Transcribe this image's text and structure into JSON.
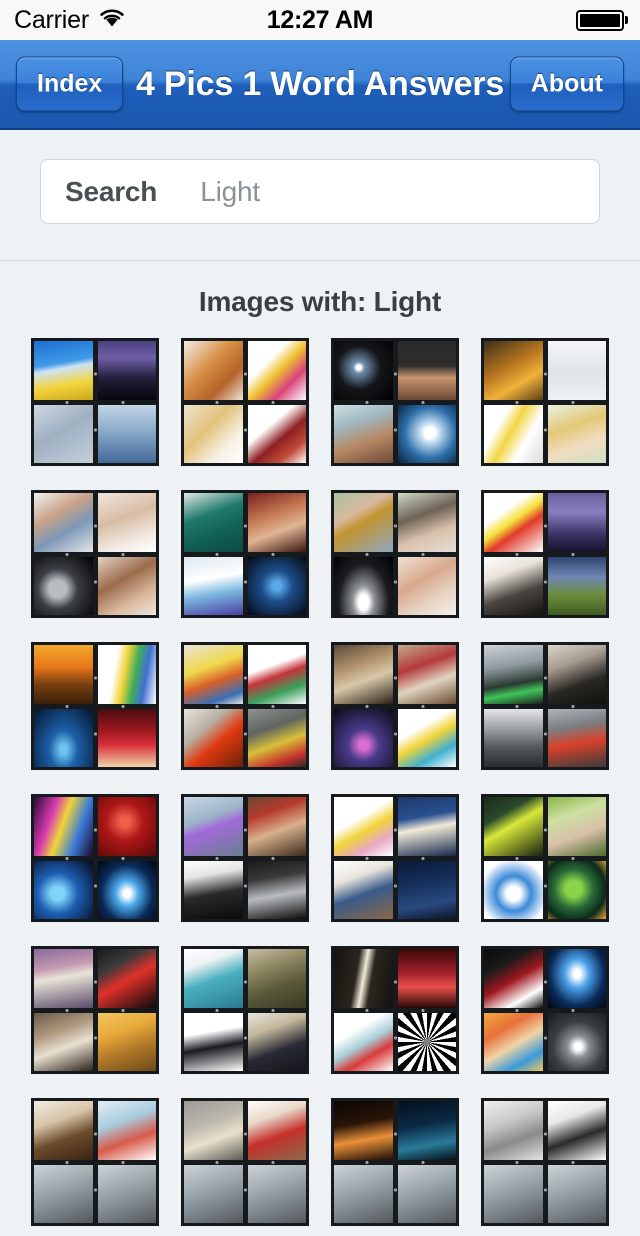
{
  "status_bar": {
    "carrier": "Carrier",
    "wifi_icon": "wifi-icon",
    "time": "12:27 AM",
    "battery_icon": "battery-full-icon"
  },
  "nav_bar": {
    "title": "4 Pics 1 Word Answers",
    "left_button": "Index",
    "right_button": "About",
    "accent_color": "#2a6ccb"
  },
  "search": {
    "label": "Search",
    "value": "Light",
    "placeholder": "Search"
  },
  "results": {
    "heading": "Images with: Light",
    "tiles": [
      {
        "name": "puzzle-sunflowers-lightning-frost-rain",
        "panes": [
          {
            "desc": "sun-over-sunflower-field",
            "css": "linear-gradient(170deg,#1d6fd0 0%,#3f9ae8 38%,#cfe4f4 47%,#f3d33a 72%,#c9a81d 100%)"
          },
          {
            "desc": "lightning-bolt-night-sky",
            "css": "linear-gradient(180deg,#4b3f7e 0%,#6f5fa8 28%,#241f3d 62%,#07060c 100%)"
          },
          {
            "desc": "frosted-leaves-monochrome",
            "css": "linear-gradient(150deg,#cfd8e2 0%,#9fb0c2 45%,#c4ced9 100%)"
          },
          {
            "desc": "blue-rain-on-water",
            "css": "linear-gradient(180deg,#c3d4e6 0%,#8fb0cd 40%,#44699a 100%)"
          }
        ]
      },
      {
        "name": "puzzle-redhead-confetti-blonde-filmstrip",
        "panes": [
          {
            "desc": "redhead-woman-red-lips",
            "css": "linear-gradient(135deg,#f2ece6 0%,#d79044 42%,#b4622a 70%,#f0e2d6 100%)"
          },
          {
            "desc": "colorful-paint-splashes",
            "css": "linear-gradient(135deg,#ffffff 0%,#ffffff 34%,#f0c230 52%,#d8427a 72%,#ffffff 100%)"
          },
          {
            "desc": "blonde-curly-hair-woman",
            "css": "linear-gradient(135deg,#efe4d2 0%,#e2c27a 40%,#f7efe3 72%,#ffffff 100%)"
          },
          {
            "desc": "red-film-strip",
            "css": "linear-gradient(140deg,#ffffff 0%,#ffffff 36%,#8e1f22 58%,#c24b3a 78%,#ffffff 100%)"
          }
        ]
      },
      {
        "name": "puzzle-disco-ball-halo-woman-bulb",
        "panes": [
          {
            "desc": "disco-ball-in-dark",
            "css": "radial-gradient(circle at 42% 45%, #ffffff 0 5%, #6f8fae 12%, #141619 46%, #000000 100%)"
          },
          {
            "desc": "man-with-halo-over-head",
            "css": "linear-gradient(180deg,#2a2a2a 0%,#2e2e2e 42%,#c8926e 62%,#6b4a35 100%)"
          },
          {
            "desc": "woman-with-cloud-halo",
            "css": "linear-gradient(160deg,#cfe0e4 0%,#9fb7bf 32%,#b78763 62%,#6c4a37 100%)"
          },
          {
            "desc": "glowing-light-bulb-blue",
            "css": "radial-gradient(circle at 55% 48%, #ffffff 0 12%, #bcd7ef 24%, #2d6ea8 58%, #07203a 100%)"
          }
        ]
      },
      {
        "name": "puzzle-sunrays-snow-bulbs-blonde",
        "panes": [
          {
            "desc": "sun-rays-through-trees",
            "css": "linear-gradient(150deg,#3d3018 0%,#b5741f 42%,#f0b23a 68%,#5d3f15 100%)"
          },
          {
            "desc": "white-snowy-texture",
            "css": "linear-gradient(180deg,#f4f6f8 0%,#dfe4e8 55%,#eef1f3 100%)"
          },
          {
            "desc": "yellow-and-white-light-bulbs",
            "css": "linear-gradient(120deg,#ffffff 0%,#ffffff 28%,#f3d544 46%,#ffffff 68%,#dcdcdc 100%)"
          },
          {
            "desc": "smiling-blonde-woman",
            "css": "linear-gradient(160deg,#e9f0e0 0%,#e3c877 38%,#f0ddc0 66%,#cfe0c2 100%)"
          }
        ]
      },
      {
        "name": "puzzle-whisper-sleeping-child-shadow-shush",
        "panes": [
          {
            "desc": "woman-whispering-to-man",
            "css": "linear-gradient(150deg,#f2f2f2 0%,#c9a288 36%,#7c98b8 62%,#e6e6e6 100%)"
          },
          {
            "desc": "child-sleeping-with-teddy",
            "css": "linear-gradient(160deg,#efe6df 0%,#d8bda4 42%,#f3ece6 78%,#ffffff 100%)"
          },
          {
            "desc": "silhouette-spotlight-dark",
            "css": "radial-gradient(circle at 40% 55%, #b9bdc1 0 18%, #3b3f43 42%, #000000 100%)"
          },
          {
            "desc": "woman-shushing-finger-to-lips",
            "css": "linear-gradient(150deg,#e3d2c4 0%,#9c6b4b 40%,#d8b79c 70%,#f0e6de 100%)"
          }
        ]
      },
      {
        "name": "puzzle-surgeons-audience-lab-concert",
        "panes": [
          {
            "desc": "surgeons-in-operating-room",
            "css": "linear-gradient(160deg,#dfe8e4 0%,#1f7a6a 38%,#116055 66%,#0d4a43 100%)"
          },
          {
            "desc": "audience-applauding-theater",
            "css": "linear-gradient(160deg,#7a1f1f 0%,#c57a52 38%,#e0b594 62%,#3a1410 100%)"
          },
          {
            "desc": "lab-technician-with-vials",
            "css": "linear-gradient(170deg,#dce9f2 0%,#ffffff 38%,#7cb7e0 62%,#4a3fa0 100%)"
          },
          {
            "desc": "singer-on-stage-blue-light",
            "css": "radial-gradient(circle at 50% 50%, #5aa8e8 0 10%, #1c4e8a 38%, #050912 100%)"
          }
        ]
      },
      {
        "name": "puzzle-binoculars-camera-spotlight-mirror",
        "panes": [
          {
            "desc": "woman-with-binoculars",
            "css": "linear-gradient(150deg,#a8c3a0 0%,#d9b9a0 34%,#c2942f 50%,#8fa8c0 100%)"
          },
          {
            "desc": "couple-taking-photo",
            "css": "linear-gradient(160deg,#cdd9c6 0%,#6e6356 38%,#d8c0ab 66%,#e4e0d6 100%)"
          },
          {
            "desc": "stage-spotlight-beam-dark",
            "css": "radial-gradient(ellipse at 50% 78%, #ffffff 0 12%, #8d9196 26%, #1a1c1f 60%, #000000 100%)"
          },
          {
            "desc": "woman-applying-makeup",
            "css": "linear-gradient(150deg,#f0e1d6 0%,#d8a98c 40%,#e8d3c4 70%,#f5efe9 100%)"
          }
        ]
      },
      {
        "name": "puzzle-lightning-bolt-storm-photographer-field",
        "panes": [
          {
            "desc": "yellow-lightning-bolt-icon",
            "css": "linear-gradient(145deg,#ffffff 0%,#ffffff 32%,#f3e13a 48%,#e03a2a 62%,#ffffff 100%)"
          },
          {
            "desc": "purple-lightning-storm",
            "css": "linear-gradient(180deg,#6a5f9c 0%,#8b7fc0 32%,#3b3366 70%,#141129 100%)"
          },
          {
            "desc": "photographer-with-camera",
            "css": "linear-gradient(160deg,#ffffff 0%,#e8e2da 30%,#4a4540 62%,#16140f 100%)"
          },
          {
            "desc": "lightning-over-green-field",
            "css": "linear-gradient(180deg,#2f4470 0%,#6f86b4 34%,#6d8d3c 66%,#3f5a22 100%)"
          }
        ]
      },
      {
        "name": "puzzle-sunset-chart-stagelights-curtain",
        "panes": [
          {
            "desc": "orange-sunset-silhouette",
            "css": "linear-gradient(180deg,#f0a828 0%,#e8771d 38%,#7a4010 66%,#3a2008 100%)"
          },
          {
            "desc": "colorful-weeks-chart",
            "css": "linear-gradient(100deg,#ffffff 0%,#ffffff 30%,#f0d43a 46%,#3fae5a 62%,#3f6fd0 78%,#ffffff 100%)"
          },
          {
            "desc": "blue-stage-lights",
            "css": "radial-gradient(ellipse at 50% 70%, #6fc4ef 0 8%, #1d5fa8 34%, #04142c 100%)"
          },
          {
            "desc": "red-theater-curtain",
            "css": "linear-gradient(180deg,#4a0b10 0%,#a01820 38%,#d8303a 62%,#f0d4a8 100%)"
          }
        ]
      },
      {
        "name": "puzzle-color-swatches-kids-taillight-carlights",
        "panes": [
          {
            "desc": "color-swatch-palette-board",
            "css": "linear-gradient(160deg,#e8e4da 0%,#f0d84a 38%,#d8602a 60%,#3a6fb4 84%,#e8e4da 100%)"
          },
          {
            "desc": "two-children-pointing",
            "css": "linear-gradient(160deg,#ffffff 0%,#ffffff 36%,#c4343a 52%,#3aa05a 74%,#ffffff 100%)"
          },
          {
            "desc": "car-tail-light-close-up",
            "css": "linear-gradient(140deg,#e8e4dc 0%,#b8b0a4 34%,#e03a10 58%,#6a2008 100%)"
          },
          {
            "desc": "car-lights-on-road",
            "css": "linear-gradient(160deg,#8e9490 0%,#5f6460 34%,#d8c03a 58%,#c4302a 82%,#2a2c28 100%)"
          }
        ]
      },
      {
        "name": "puzzle-girl-flashlight-family-reading-gamer-idea",
        "panes": [
          {
            "desc": "girl-with-flashlight-in-tent",
            "css": "linear-gradient(160deg,#5a4a3a 0%,#b08f6a 34%,#d8c8a8 58%,#2a2018 100%)"
          },
          {
            "desc": "family-reading-book-together",
            "css": "linear-gradient(160deg,#c4a88c 0%,#b43a3a 36%,#e0d4c0 62%,#6a4a30 100%)"
          },
          {
            "desc": "gamer-with-glowing-tablet",
            "css": "radial-gradient(circle at 50% 62%, #d86fd0 0 10%, #4a3a8a 34%, #0a0a14 100%)"
          },
          {
            "desc": "yellow-idea-bulb-with-gems",
            "css": "linear-gradient(150deg,#ffffff 0%,#ffffff 34%,#f0d43a 52%,#3fb0d0 74%,#ffffff 100%)"
          }
        ]
      },
      {
        "name": "puzzle-traffic-light-man-city-street-traffic",
        "panes": [
          {
            "desc": "green-traffic-light",
            "css": "linear-gradient(170deg,#cdd4d8 0%,#8f9aa0 36%,#2a3a30 64%,#3fc45a 78%,#1a221c 100%)"
          },
          {
            "desc": "man-in-suit-holding-light",
            "css": "linear-gradient(160deg,#d8d4cc 0%,#a89c90 32%,#2a2824 64%,#100f0d 100%)"
          },
          {
            "desc": "black-and-white-city-street",
            "css": "linear-gradient(180deg,#e4e6e8 0%,#9ba0a4 34%,#54585c 66%,#2a2d30 100%)"
          },
          {
            "desc": "traffic-jam-red-lights",
            "css": "linear-gradient(170deg,#b0b4b8 0%,#7a7e82 32%,#d8402a 58%,#3a3c3e 100%)"
          }
        ]
      },
      {
        "name": "puzzle-neon-gradient-red-sparkle-ball-stage",
        "panes": [
          {
            "desc": "pink-neon-light-gradient",
            "css": "linear-gradient(110deg,#2a0a3a 0%,#d83ab0 30%,#f0d43a 48%,#3a7ad8 72%,#1a0a2a 100%)"
          },
          {
            "desc": "red-sparkle-bokeh",
            "css": "radial-gradient(circle at 46% 42%, #f0604a 0 10%, #b01818 40%, #5a0808 100%)"
          },
          {
            "desc": "blue-glowing-soccer-ball",
            "css": "radial-gradient(circle at 40% 56%, #7fd4f8 0 14%, #1d5fb4 42%, #04091c 100%)"
          },
          {
            "desc": "blue-stage-spotlights",
            "css": "radial-gradient(ellipse at 50% 56%, #ffffff 0 8%, #4aa8e8 28%, #0a2a58 62%, #020610 100%)"
          }
        ]
      },
      {
        "name": "puzzle-lightsaber-pirate-samurai-knight",
        "panes": [
          {
            "desc": "alien-with-lightsaber-snow",
            "css": "linear-gradient(160deg,#c8d8e4 0%,#9db4c8 36%,#a06ad8 52%,#6a7e90 100%)"
          },
          {
            "desc": "pirate-captain-with-sword",
            "css": "linear-gradient(160deg,#6a4a32 0%,#b43a2a 28%,#d8b08c 56%,#3a2a1c 100%)"
          },
          {
            "desc": "samurai-swinging-sword",
            "css": "linear-gradient(170deg,#ffffff 0%,#e4e4e4 26%,#2a2a2a 56%,#0a0a0a 100%)"
          },
          {
            "desc": "knight-in-armor",
            "css": "linear-gradient(170deg,#1a1a1a 0%,#3a3a3a 30%,#b8bcc0 58%,#0a0a0a 100%)"
          }
        ]
      },
      {
        "name": "puzzle-moon-fairy-streetlamp-sleeping-crescent",
        "panes": [
          {
            "desc": "fairy-sitting-on-crescent-moon",
            "css": "linear-gradient(150deg,#ffffff 0%,#ffffff 38%,#f0d43a 56%,#e8a8c4 76%,#ffffff 100%)"
          },
          {
            "desc": "street-lamp-at-night",
            "css": "linear-gradient(170deg,#1d3a6a 0%,#2a5090 34%,#f0ead8 52%,#14284a 100%)"
          },
          {
            "desc": "man-sleeping-in-bed",
            "css": "linear-gradient(160deg,#ffffff 0%,#e8e4dc 30%,#3a5a8a 56%,#8a6a4a 100%)"
          },
          {
            "desc": "crescent-moon-starry-sky",
            "css": "linear-gradient(170deg,#0a1a3a 0%,#16305c 40%,#2a4a80 72%,#0a1428 100%)"
          }
        ]
      },
      {
        "name": "puzzle-departure-board-travelers-globe-earth",
        "panes": [
          {
            "desc": "airport-departure-board",
            "css": "linear-gradient(150deg,#1a2a1a 0%,#2a4a2a 30%,#d8e83a 48%,#14200f 100%)"
          },
          {
            "desc": "couple-reading-map-outdoors",
            "css": "linear-gradient(160deg,#8ab44a 0%,#cde0a0 32%,#d8c0a8 62%,#4a6a2a 100%)"
          },
          {
            "desc": "travel-globe-with-landmarks",
            "css": "radial-gradient(circle at 50% 56%, #ffffff 0 16%, #3a8ad8 40%, #ffffff 78%)"
          },
          {
            "desc": "earth-from-space-green",
            "css": "radial-gradient(circle at 44% 48%, #8ad44a 0 18%, #2a6a3a 44%, #0a2a1a 72%, #f0a83a 100%)"
          }
        ]
      },
      {
        "name": "puzzle-lighthouse-laser-girl-tent-curtain-sun",
        "panes": [
          {
            "desc": "lighthouse-beam-at-dusk",
            "css": "linear-gradient(170deg,#8a6a9c 0%,#c49ab0 32%,#e8e4d8 48%,#5a4a6a 100%)"
          },
          {
            "desc": "red-laser-device",
            "css": "linear-gradient(150deg,#1a1a1a 0%,#3a3a3a 28%,#e0302a 52%,#0a0a0a 100%)"
          },
          {
            "desc": "girl-with-lantern-in-tent",
            "css": "linear-gradient(160deg,#6a5a4a 0%,#b09a80 34%,#e8e0d0 58%,#2a2218 100%)"
          },
          {
            "desc": "sunlight-through-curtains",
            "css": "linear-gradient(160deg,#f0c860 0%,#e8a83a 34%,#b07828 62%,#6a4a18 100%)"
          }
        ]
      },
      {
        "name": "puzzle-medical-team-soldiers-uniform-staff",
        "panes": [
          {
            "desc": "medical-team-in-scrubs",
            "css": "linear-gradient(160deg,#ffffff 0%,#eef2f4 26%,#4ab0c0 52%,#2a7a90 100%)"
          },
          {
            "desc": "soldiers-in-camouflage",
            "css": "linear-gradient(160deg,#c8c0a0 0%,#8a8460 34%,#5a5a3a 62%,#3a3a24 100%)"
          },
          {
            "desc": "woman-in-black-uniform",
            "css": "linear-gradient(170deg,#ffffff 0%,#ffffff 34%,#1a1a20 58%,#ffffff 100%)"
          },
          {
            "desc": "flight-crew-with-clipboard",
            "css": "linear-gradient(160deg,#e8e4de 0%,#c4b89c 30%,#2a2a34 62%,#14141c 100%)"
          }
        ]
      },
      {
        "name": "puzzle-light-beam-stage-ticket-spiral",
        "panes": [
          {
            "desc": "vertical-light-beam-dark-room",
            "css": "linear-gradient(100deg,#14120f 0%,#2a261f 38%,#f0ead8 50%,#2a261f 62%,#14120f 100%)"
          },
          {
            "desc": "red-lit-empty-stage",
            "css": "linear-gradient(180deg,#3a0808 0%,#a02028 40%,#e8504a 64%,#2a0606 100%)"
          },
          {
            "desc": "movie-ticket-illustration",
            "css": "linear-gradient(150deg,#ffffff 0%,#ffffff 32%,#a8d0d8 52%,#d83a3a 70%,#ffffff 100%)"
          },
          {
            "desc": "black-and-white-spiral-pattern",
            "css": "repeating-conic-gradient(from 0deg at 50% 50%, #000 0deg 10deg, #fff 10deg 20deg)"
          }
        ]
      },
      {
        "name": "puzzle-magician-curtain-stage-lights-confetti-magic",
        "panes": [
          {
            "desc": "magician-hand-behind-curtain",
            "css": "linear-gradient(150deg,#0a0a0a 0%,#1a1a1a 28%,#a01820 52%,#ffffff 78%,#0a0a0a 100%)"
          },
          {
            "desc": "blue-stage-spotlights-beams",
            "css": "radial-gradient(ellipse at 50% 42%, #ffffff 0 8%, #4aa0e8 30%, #0a2a58 66%, #020610 100%)"
          },
          {
            "desc": "woman-with-colorful-confetti",
            "css": "linear-gradient(150deg,#f0a83a 0%,#e8703a 30%,#f0d4a8 54%,#3a9ad8 78%,#f0c860 100%)"
          },
          {
            "desc": "magic-hat-with-sparkles",
            "css": "radial-gradient(circle at 52% 58%, #ffffff 0 8%, #8a8e92 24%, #3a3e42 56%, #1a1c1e 100%)"
          }
        ]
      },
      {
        "name": "puzzle-partial-row-six-a",
        "panes": [
          {
            "desc": "two-brown-round-objects",
            "css": "linear-gradient(160deg,#f0ece4 0%,#d8c4a8 34%,#6a4a2a 62%,#3a2414 100%)"
          },
          {
            "desc": "blue-and-red-light-object",
            "css": "linear-gradient(160deg,#e4eef4 0%,#a8cce0 36%,#d85a4a 64%,#ffffff 100%)"
          },
          {
            "desc": "hidden-pane-lower-left",
            "css": "linear-gradient(160deg,#cdd4d8 0%,#8f9aa0 50%,#54585c 100%)"
          },
          {
            "desc": "hidden-pane-lower-right",
            "css": "linear-gradient(160deg,#cdd4d8 0%,#8f9aa0 50%,#54585c 100%)"
          }
        ]
      },
      {
        "name": "puzzle-partial-row-six-b",
        "panes": [
          {
            "desc": "framed-picture-on-wall",
            "css": "linear-gradient(160deg,#9a9a96 0%,#bcb8ae 38%,#e8e0cc 62%,#5a5a56 100%)"
          },
          {
            "desc": "woman-holding-red-object",
            "css": "linear-gradient(160deg,#ffffff 0%,#e8d8c8 30%,#c4302a 58%,#8a6a4a 100%)"
          },
          {
            "desc": "hidden-pane-lower-left",
            "css": "linear-gradient(160deg,#cdd4d8 0%,#8f9aa0 50%,#54585c 100%)"
          },
          {
            "desc": "hidden-pane-lower-right",
            "css": "linear-gradient(160deg,#cdd4d8 0%,#8f9aa0 50%,#54585c 100%)"
          }
        ]
      },
      {
        "name": "puzzle-partial-row-six-c",
        "panes": [
          {
            "desc": "candles-in-the-dark",
            "css": "linear-gradient(170deg,#0a0604 0%,#2a1408 38%,#e8903a 64%,#1a0c04 100%)"
          },
          {
            "desc": "blue-night-sky-light",
            "css": "linear-gradient(170deg,#04101c 0%,#0a2a44 40%,#2a7a9a 72%,#041018 100%)"
          },
          {
            "desc": "hidden-pane-lower-left",
            "css": "linear-gradient(160deg,#cdd4d8 0%,#8f9aa0 50%,#54585c 100%)"
          },
          {
            "desc": "hidden-pane-lower-right",
            "css": "linear-gradient(160deg,#cdd4d8 0%,#8f9aa0 50%,#54585c 100%)"
          }
        ]
      },
      {
        "name": "puzzle-partial-row-six-d",
        "panes": [
          {
            "desc": "grey-cylinder-object",
            "css": "linear-gradient(160deg,#f0f0f0 0%,#c8c8c8 36%,#8a8a8a 64%,#e4e4e4 100%)"
          },
          {
            "desc": "black-ornate-lamp",
            "css": "linear-gradient(160deg,#ffffff 0%,#e8e8e8 30%,#2a2a2a 60%,#ffffff 100%)"
          },
          {
            "desc": "hidden-pane-lower-left",
            "css": "linear-gradient(160deg,#cdd4d8 0%,#8f9aa0 50%,#54585c 100%)"
          },
          {
            "desc": "hidden-pane-lower-right",
            "css": "linear-gradient(160deg,#cdd4d8 0%,#8f9aa0 50%,#54585c 100%)"
          }
        ]
      }
    ]
  }
}
